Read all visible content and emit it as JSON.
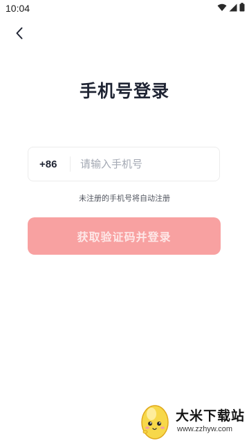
{
  "status_bar": {
    "time": "10:04",
    "icons": [
      "wifi-icon",
      "signal-icon",
      "battery-icon"
    ]
  },
  "nav": {
    "back_icon": "chevron-left-icon"
  },
  "title": "手机号登录",
  "phone_field": {
    "country_code": "+86",
    "placeholder": "请输入手机号",
    "value": ""
  },
  "hint": "未注册的手机号将自动注册",
  "submit": {
    "label": "获取验证码并登录",
    "enabled": false,
    "color": "#f8a1a1"
  },
  "watermark": {
    "title": "大米下载站",
    "url": "www.zzhyw.com"
  },
  "colors": {
    "title": "#1f2433",
    "placeholder": "#a3a8b3",
    "button_disabled": "#f8a1a1",
    "button_text": "#fde7e7"
  }
}
